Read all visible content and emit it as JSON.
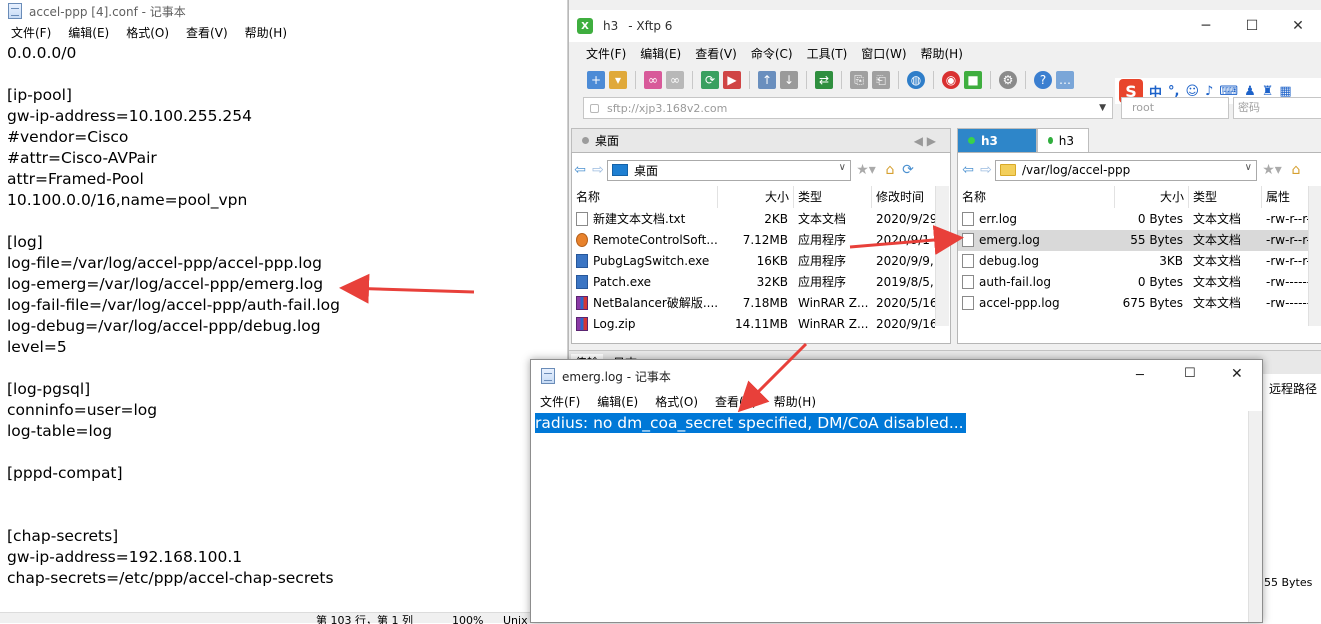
{
  "notepad_main": {
    "title": "accel-ppp [4].conf - 记事本",
    "menu": [
      "文件(F)",
      "编辑(E)",
      "格式(O)",
      "查看(V)",
      "帮助(H)"
    ],
    "lines": [
      "0.0.0.0/0",
      "",
      "[ip-pool]",
      "gw-ip-address=10.100.255.254",
      "#vendor=Cisco",
      "#attr=Cisco-AVPair",
      "attr=Framed-Pool",
      "10.100.0.0/16,name=pool_vpn",
      "",
      "[log]",
      "log-file=/var/log/accel-ppp/accel-ppp.log",
      "log-emerg=/var/log/accel-ppp/emerg.log",
      "log-fail-file=/var/log/accel-ppp/auth-fail.log",
      "log-debug=/var/log/accel-ppp/debug.log",
      "level=5",
      "",
      "[log-pgsql]",
      "conninfo=user=log",
      "log-table=log",
      "",
      "[pppd-compat]",
      "",
      "",
      "[chap-secrets]",
      "gw-ip-address=192.168.100.1",
      "chap-secrets=/etc/ppp/accel-chap-secrets"
    ],
    "status": {
      "position": "第 103 行，第 1 列",
      "zoom": "100%",
      "encoding": "Unix"
    }
  },
  "xftp": {
    "title_session": "h3",
    "title_app": "- Xftp 6",
    "menu": [
      "文件(F)",
      "编辑(E)",
      "查看(V)",
      "命令(C)",
      "工具(T)",
      "窗口(W)",
      "帮助(H)"
    ],
    "address": "sftp://xjp3.168v2.com",
    "user_placeholder": "root",
    "password_placeholder": "密码",
    "ime": {
      "logo": "S",
      "lang": "中"
    },
    "local": {
      "tab": "桌面",
      "path": "桌面",
      "columns": [
        "名称",
        "大小",
        "类型",
        "修改时间"
      ],
      "files": [
        {
          "name": "新建文本文档.txt",
          "size": "2KB",
          "type": "文本文档",
          "mtime": "2020/9/29"
        },
        {
          "name": "RemoteControlSoft...",
          "size": "7.12MB",
          "type": "应用程序",
          "mtime": "2020/9/1"
        },
        {
          "name": "PubgLagSwitch.exe",
          "size": "16KB",
          "type": "应用程序",
          "mtime": "2020/9/9,"
        },
        {
          "name": "Patch.exe",
          "size": "32KB",
          "type": "应用程序",
          "mtime": "2019/8/5,"
        },
        {
          "name": "NetBalancer破解版....",
          "size": "7.18MB",
          "type": "WinRAR Z...",
          "mtime": "2020/5/16"
        },
        {
          "name": "Log.zip",
          "size": "14.11MB",
          "type": "WinRAR Z...",
          "mtime": "2020/9/16"
        }
      ]
    },
    "remote": {
      "tabs": [
        "h3",
        "h3"
      ],
      "path": "/var/log/accel-ppp",
      "columns": [
        "名称",
        "大小",
        "类型",
        "属性"
      ],
      "files": [
        {
          "name": "err.log",
          "size": "0 Bytes",
          "type": "文本文档",
          "attr": "-rw-r--r--"
        },
        {
          "name": "emerg.log",
          "size": "55 Bytes",
          "type": "文本文档",
          "attr": "-rw-r--r--"
        },
        {
          "name": "debug.log",
          "size": "3KB",
          "type": "文本文档",
          "attr": "-rw-r--r--"
        },
        {
          "name": "auth-fail.log",
          "size": "0 Bytes",
          "type": "文本文档",
          "attr": "-rw-------"
        },
        {
          "name": "accel-ppp.log",
          "size": "675 Bytes",
          "type": "文本文档",
          "attr": "-rw-------"
        }
      ]
    },
    "transfer_hdr_left": "传输",
    "transfer_hdr_right": "日志",
    "remote_path_col": "远程路径",
    "transfer_size": "55 Bytes"
  },
  "notepad_emerg": {
    "title": "emerg.log - 记事本",
    "menu": [
      "文件(F)",
      "编辑(E)",
      "格式(O)",
      "查看(V)",
      "帮助(H)"
    ],
    "content": "radius: no dm_coa_secret specified, DM/CoA disabled..."
  },
  "colors": {
    "arrow": "#e8403a",
    "selection": "#0078d7",
    "xftp_tab_active": "#2e86c9"
  }
}
